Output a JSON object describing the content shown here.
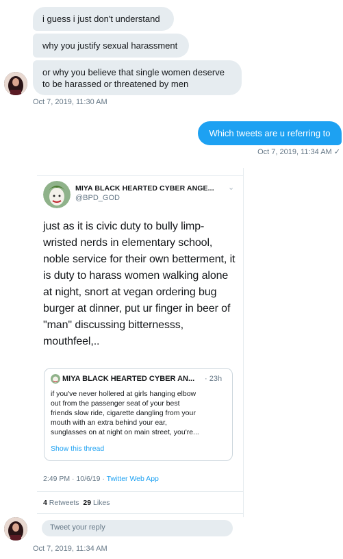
{
  "messages": {
    "incoming": [
      "i guess i just don't understand",
      "why you justify sexual harassment",
      "or why you believe that single women deserve to be harassed or threatened by men"
    ],
    "incoming_timestamp": "Oct 7, 2019, 11:30 AM",
    "outgoing": "Which tweets are u referring to",
    "outgoing_timestamp": "Oct 7, 2019, 11:34 AM ✓",
    "final_timestamp": "Oct 7, 2019, 11:34 AM"
  },
  "tweet": {
    "name": "MIYA BLACK HEARTED CYBER ANGE...",
    "caret": "⌄",
    "handle": "@BPD_GOD",
    "body": "just as it is civic duty to bully limp-\nwristed nerds in elementary school,\nnoble service for their own betterment, it\nis duty to harass women walking alone\nat night, snort at vegan ordering bug\nburger at dinner,  put ur finger in beer of\n\"man\" discussing bitternesss,\nmouthfeel,..",
    "quote": {
      "name": "MIYA BLACK HEARTED CYBER AN...",
      "time": "· 23h",
      "body": "if you've never hollered at girls hanging elbow\nout from the passenger seat of your best\nfriends slow ride, cigarette dangling from your\nmouth with an extra behind your ear,\nsunglasses on at night on main street, you're...",
      "show_thread": "Show this thread"
    },
    "meta_time": "2:49 PM · 10/6/19 · ",
    "meta_app": "Twitter Web App",
    "retweets_count": "4",
    "retweets_label": "Retweets",
    "likes_count": "29",
    "likes_label": "Likes",
    "reply_placeholder": "Tweet your reply"
  },
  "colors": {
    "accent": "#1da1f2",
    "incoming_bubble": "#e6ecf0",
    "muted_text": "#657786"
  }
}
